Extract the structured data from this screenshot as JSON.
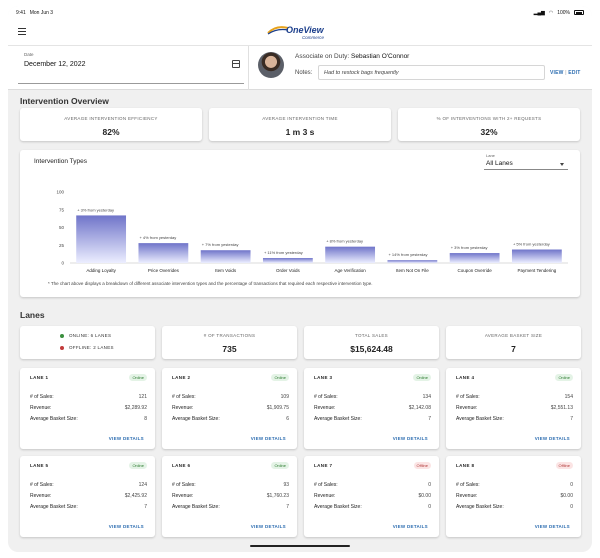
{
  "status_bar": {
    "time": "9:41",
    "date": "Mon Jun 3",
    "battery": "100%"
  },
  "brand": {
    "name": "OneView",
    "tagline": "Commerce",
    "color": "#1c3f8c"
  },
  "header": {
    "date_label": "Date",
    "date_value": "December 12, 2022",
    "associate_label": "Associate on Duty:",
    "associate_name": "Sebastian O'Connor",
    "notes_label": "Notes:",
    "notes_value": "Had to restock bags frequently",
    "view_label": "VIEW",
    "separator": "|",
    "edit_label": "EDIT"
  },
  "intervention_overview": {
    "title": "Intervention Overview",
    "stats": [
      {
        "label": "AVERAGE INTERVENTION EFFICIENCY",
        "value": "82%"
      },
      {
        "label": "AVERAGE INTERVENTION TIME",
        "value": "1 m 3 s"
      },
      {
        "label": "% OF INTERVENTIONS WITH 2+ REQUESTS",
        "value": "32%"
      }
    ]
  },
  "chart_card": {
    "title": "Intervention Types",
    "lane_select_label": "Lane",
    "lane_select_value": "All Lanes",
    "note": "* The chart above displays a breakdown of different associate intervention types and the percentage of transactions that required each respective intervention type."
  },
  "chart_data": {
    "type": "bar",
    "title": "Intervention Types",
    "categories": [
      "Adding Loyalty",
      "Price Overrides",
      "Item Voids",
      "Order Voids",
      "Age Verification",
      "Item Not On File",
      "Coupon Override",
      "Payment Tendering"
    ],
    "values": [
      67,
      28,
      18,
      7,
      23,
      4,
      14,
      19
    ],
    "annotations": [
      "+ 3% from yesterday",
      "+ 4% from yesterday",
      "+ 7% from yesterday",
      "+ 11% from yesterday",
      "+ 8% from yesterday",
      "+ 14% from yesterday",
      "+ 3% from yesterday",
      "+ 5% from yesterday"
    ],
    "yticks": [
      0,
      25,
      50,
      75,
      100
    ],
    "ylim": [
      0,
      100
    ],
    "xlabel": "",
    "ylabel": "",
    "grid": false,
    "bar_color_top": "#6f74c9",
    "bar_color_bottom": "#eceeff"
  },
  "lanes": {
    "title": "Lanes",
    "online_label": "ONLINE: 6 LANES",
    "offline_label": "OFFLINE: 2 LANES",
    "online_color": "#3a8f3e",
    "offline_color": "#c23b3b",
    "summary": [
      {
        "label": "# OF TRANSACTIONS",
        "value": "735"
      },
      {
        "label": "TOTAL SALES",
        "value": "$15,624.48"
      },
      {
        "label": "AVERAGE BASKET SIZE",
        "value": "7"
      }
    ],
    "field_labels": {
      "sales": "# of Sales:",
      "revenue": "Revenue:",
      "basket": "Average Basket Size:"
    },
    "view_details_label": "VIEW DETAILS",
    "items": [
      {
        "name": "LANE 1",
        "status": "Online",
        "sales": "121",
        "revenue": "$2,289.92",
        "basket": "8"
      },
      {
        "name": "LANE 2",
        "status": "Online",
        "sales": "109",
        "revenue": "$1,909.75",
        "basket": "6"
      },
      {
        "name": "LANE 3",
        "status": "Online",
        "sales": "134",
        "revenue": "$2,142.08",
        "basket": "7"
      },
      {
        "name": "LANE 4",
        "status": "Online",
        "sales": "154",
        "revenue": "$2,551.13",
        "basket": "7"
      },
      {
        "name": "LANE 5",
        "status": "Online",
        "sales": "124",
        "revenue": "$2,425.92",
        "basket": "7"
      },
      {
        "name": "LANE 6",
        "status": "Online",
        "sales": "93",
        "revenue": "$1,760.23",
        "basket": "7"
      },
      {
        "name": "LANE 7",
        "status": "Offline",
        "sales": "0",
        "revenue": "$0.00",
        "basket": "0"
      },
      {
        "name": "LANE 8",
        "status": "Offline",
        "sales": "0",
        "revenue": "$0.00",
        "basket": "0"
      }
    ]
  }
}
